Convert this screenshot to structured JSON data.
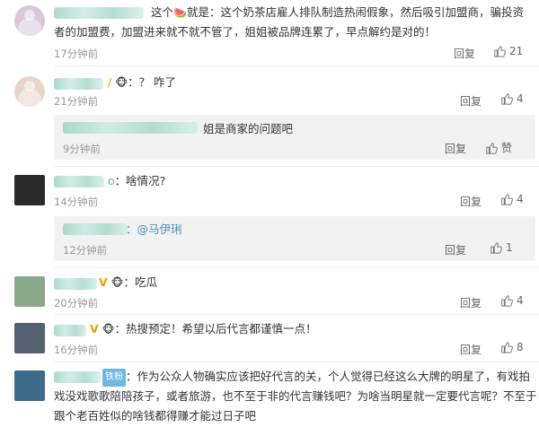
{
  "comments": [
    {
      "text_before": "这个",
      "text_after": "就是：这个奶茶店雇人排队制造热闹假象，然后吸引加盟商，骗投资",
      "text_line2": "者的加盟费，加盟进来就不就不管了，姐姐被品牌连累了，早点解约是对的！",
      "time": "17分钟前",
      "reply": "回复",
      "likes": "21",
      "watermelon_emoji": "🍉"
    },
    {
      "name_suffix": "/",
      "text": "：？ 咋了",
      "time": "21分钟前",
      "reply": "回复",
      "likes": "4",
      "sub_reply": {
        "text": "姐是商家的问题吧",
        "time": "9分钟前",
        "reply": "回复",
        "likes": "赞"
      }
    },
    {
      "name_suffix": "o",
      "text": "：啥情况?",
      "time": "14分钟前",
      "reply": "回复",
      "likes": "4",
      "sub_reply": {
        "text": "：@马伊琍",
        "mention": "@马伊琍",
        "time": "12分钟前",
        "reply": "回复",
        "likes": "1"
      }
    },
    {
      "name_suffix": "V",
      "text": "：吃瓜",
      "time": "20分钟前",
      "reply": "回复",
      "likes": "4"
    },
    {
      "name_suffix": "V",
      "text": "：热搜预定！希望以后代言都谨慎一点！",
      "time": "16分钟前",
      "reply": "回复",
      "likes": "8"
    },
    {
      "badge": "铁粉",
      "text_line1": "：作为公众人物确实应该把好代言的关，个人觉得已经这么大牌的明星了，有戏拍",
      "text_line2": "戏没戏歌歌陪陪孩子，或者旅游，也不至于非的代言赚钱吧？为啥当明星就一定要代言呢？不至于",
      "text_line3": "跟个老百姓似的啥钱都得赚才能过日子吧"
    }
  ]
}
